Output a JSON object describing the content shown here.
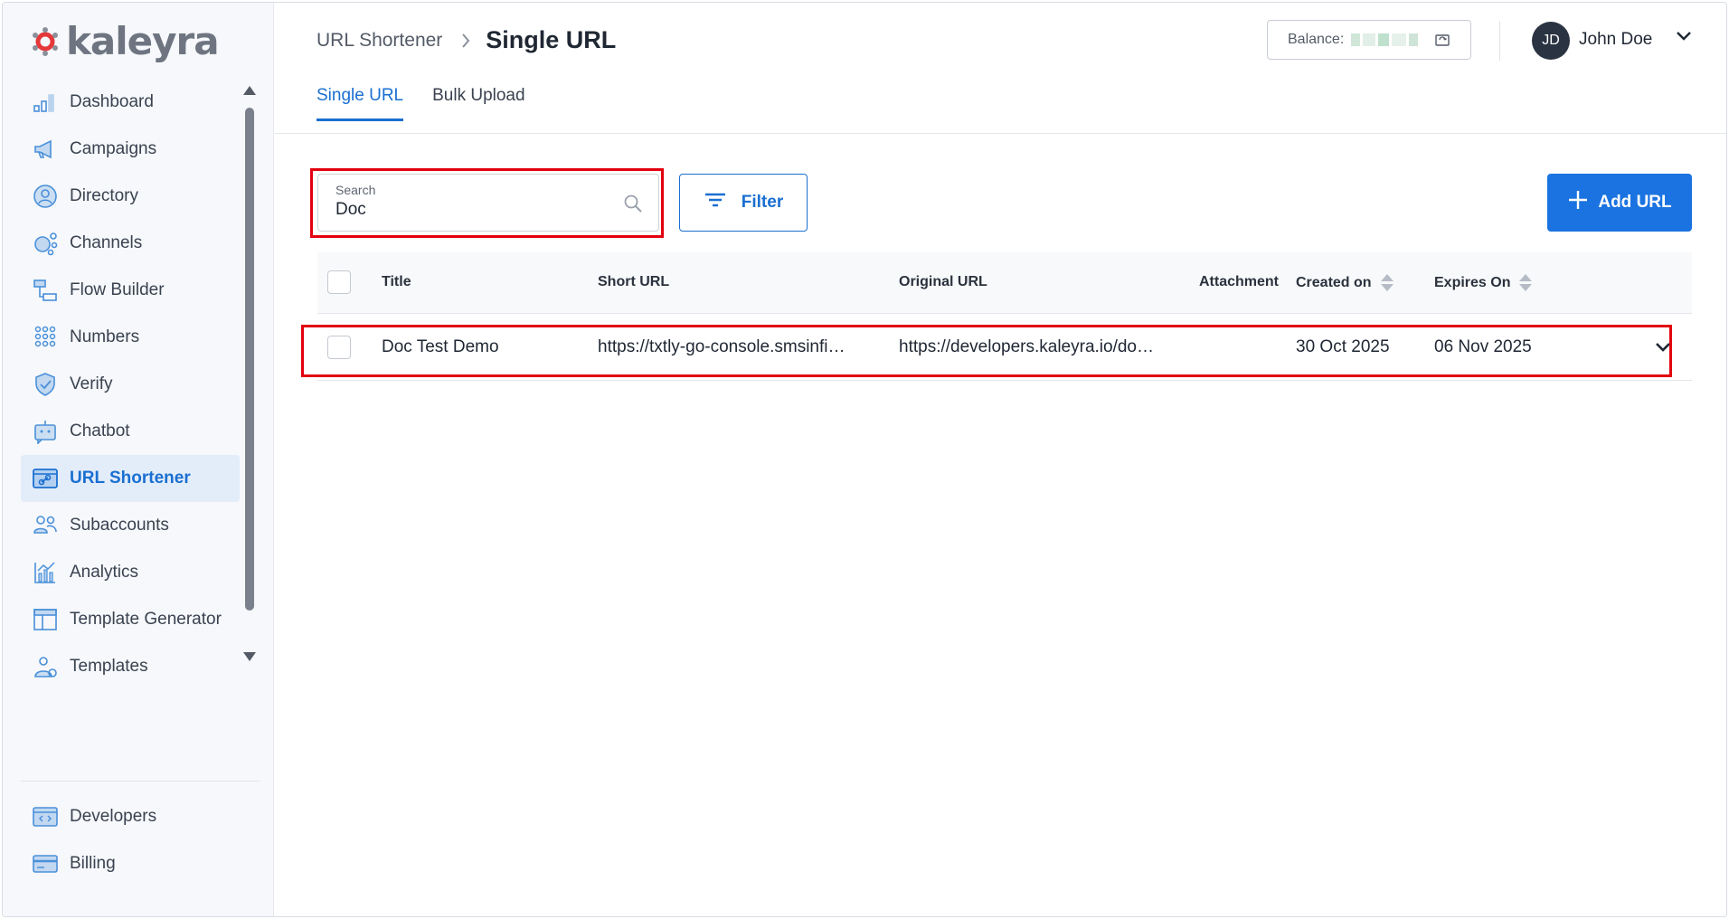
{
  "brand": {
    "name": "kaleyra"
  },
  "sidebar": {
    "items": [
      {
        "label": "Dashboard",
        "icon": "dashboard-icon"
      },
      {
        "label": "Campaigns",
        "icon": "megaphone-icon"
      },
      {
        "label": "Directory",
        "icon": "user-circle-icon"
      },
      {
        "label": "Channels",
        "icon": "channels-icon"
      },
      {
        "label": "Flow Builder",
        "icon": "flow-builder-icon"
      },
      {
        "label": "Numbers",
        "icon": "dialpad-icon"
      },
      {
        "label": "Verify",
        "icon": "shield-check-icon"
      },
      {
        "label": "Chatbot",
        "icon": "chatbot-icon"
      },
      {
        "label": "URL Shortener",
        "icon": "link-icon",
        "active": true
      },
      {
        "label": "Subaccounts",
        "icon": "users-icon"
      },
      {
        "label": "Analytics",
        "icon": "analytics-icon"
      },
      {
        "label": "Template Generator",
        "icon": "template-generator-icon"
      },
      {
        "label": "Templates",
        "icon": "templates-icon"
      }
    ],
    "bottom": [
      {
        "label": "Developers",
        "icon": "code-icon"
      },
      {
        "label": "Billing",
        "icon": "credit-card-icon"
      }
    ]
  },
  "header": {
    "breadcrumb_parent": "URL Shortener",
    "breadcrumb_current": "Single URL",
    "balance_label": "Balance:",
    "user_initials": "JD",
    "user_name": "John Doe"
  },
  "tabs": [
    {
      "label": "Single URL",
      "active": true
    },
    {
      "label": "Bulk Upload",
      "active": false
    }
  ],
  "toolbar": {
    "search_label": "Search",
    "search_value": "Doc",
    "filter_label": "Filter",
    "add_label": "Add URL"
  },
  "table": {
    "columns": [
      "Title",
      "Short URL",
      "Original URL",
      "Attachment",
      "Created on",
      "Expires On"
    ],
    "rows": [
      {
        "title": "Doc Test Demo",
        "short_url": "https://txtly-go-console.smsinfi…",
        "original_url": "https://developers.kaleyra.io/do…",
        "attachment": "",
        "created_on": "30 Oct 2025",
        "expires_on": "06 Nov 2025"
      }
    ]
  },
  "colors": {
    "accent": "#1a6fd1",
    "primary_button": "#1a73e0",
    "highlight": "#e3000f",
    "sidebar_bg": "#f6f8fb"
  }
}
